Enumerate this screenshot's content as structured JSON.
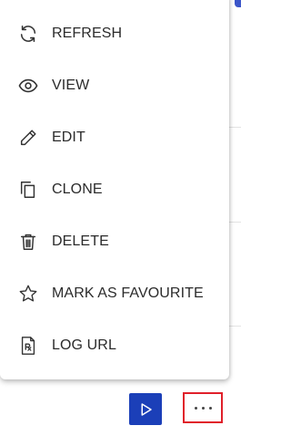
{
  "menu": {
    "items": [
      {
        "label": "REFRESH",
        "icon": "refresh-icon"
      },
      {
        "label": "VIEW",
        "icon": "eye-icon"
      },
      {
        "label": "EDIT",
        "icon": "pencil-icon"
      },
      {
        "label": "CLONE",
        "icon": "clone-icon"
      },
      {
        "label": "DELETE",
        "icon": "trash-icon"
      },
      {
        "label": "MARK AS FAVOURITE",
        "icon": "star-icon"
      },
      {
        "label": "LOG URL",
        "icon": "prescription-document-icon"
      }
    ]
  },
  "toolbar": {
    "play_icon": "play-icon",
    "more_icon": "more-options-icon"
  },
  "colors": {
    "play_button": "#1b3fb8",
    "highlight_border": "#e0202a",
    "menu_text": "#2b2b2b",
    "icon_stroke": "#333333"
  }
}
